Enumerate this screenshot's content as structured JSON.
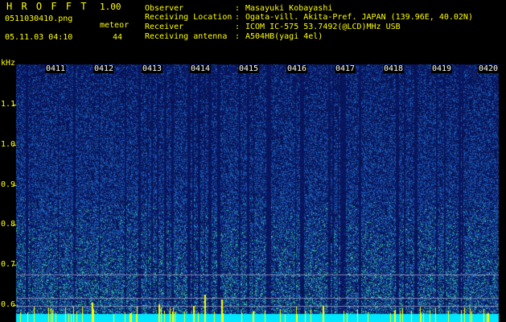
{
  "header": {
    "app_name": "H R O F F T",
    "version": "1.00",
    "file_name": "0511030410.png",
    "meteor_label": "meteor",
    "timestamp": "05.11.03 04:10",
    "meteor_count": "44"
  },
  "station_info": [
    {
      "key": "Observer",
      "value": "Masayuki Kobayashi"
    },
    {
      "key": "Receiving Location",
      "value": "Ogata-vill. Akita-Pref. JAPAN (139.96E, 40.02N)"
    },
    {
      "key": "Receiver",
      "value": "ICOM IC-575 53.7492(@LCD)MHz USB"
    },
    {
      "key": "Receiving antenna",
      "value": "A504HB(yagi 4el)"
    }
  ],
  "spectrogram": {
    "y_unit": "kHz",
    "y_ticks": [
      "1.1",
      "1.0",
      "0.9",
      "0.8",
      "0.7",
      "0.6"
    ],
    "time_labels": [
      "0411",
      "0412",
      "0413",
      "0414",
      "0415",
      "0416",
      "0417",
      "0418",
      "0419",
      "0420"
    ],
    "colors": {
      "text": "#ffff00",
      "background": "#000000",
      "signal_low": "#0a1a6e",
      "signal_mid": "#1e64c8",
      "signal_high": "#3cd2b4",
      "peak": "#ffff00",
      "baseline": "#00e6ff"
    }
  }
}
